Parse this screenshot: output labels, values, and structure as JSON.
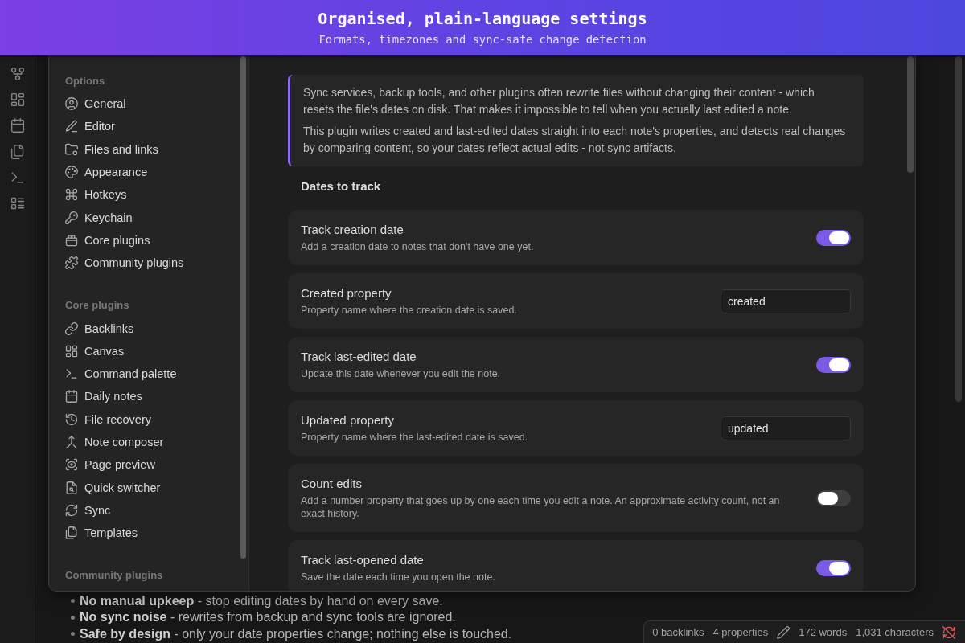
{
  "banner": {
    "title": "Organised, plain-language settings",
    "subtitle": "Formats, timezones and sync-safe change detection"
  },
  "settings_modal": {
    "sidebar": {
      "sections": [
        {
          "heading": "Options",
          "items": [
            {
              "label": "General",
              "selected": false
            },
            {
              "label": "Editor",
              "selected": false
            },
            {
              "label": "Files and links",
              "selected": false
            },
            {
              "label": "Appearance",
              "selected": false
            },
            {
              "label": "Hotkeys",
              "selected": false
            },
            {
              "label": "Keychain",
              "selected": false
            },
            {
              "label": "Core plugins",
              "selected": false
            },
            {
              "label": "Community plugins",
              "selected": false
            }
          ]
        },
        {
          "heading": "Core plugins",
          "items": [
            {
              "label": "Backlinks",
              "selected": false
            },
            {
              "label": "Canvas",
              "selected": false
            },
            {
              "label": "Command palette",
              "selected": false
            },
            {
              "label": "Daily notes",
              "selected": false
            },
            {
              "label": "File recovery",
              "selected": false
            },
            {
              "label": "Note composer",
              "selected": false
            },
            {
              "label": "Page preview",
              "selected": false
            },
            {
              "label": "Quick switcher",
              "selected": false
            },
            {
              "label": "Sync",
              "selected": false
            },
            {
              "label": "Templates",
              "selected": false
            }
          ]
        },
        {
          "heading": "Community plugins"
        }
      ]
    },
    "content": {
      "callout": {
        "paragraphs": [
          "Sync services, backup tools, and other plugins often rewrite files without changing their content - which resets the file's dates on disk. That makes it impossible to tell when you actually last edited a note.",
          "This plugin writes created and last-edited dates straight into each note's properties, and detects real changes by comparing content, so your dates reflect actual edits - not sync artifacts."
        ]
      },
      "section_heading": "Dates to track",
      "settings": [
        {
          "kind": "toggle",
          "name": "Track creation date",
          "description": "Add a creation date to notes that don't have one yet.",
          "on": true
        },
        {
          "kind": "text",
          "name": "Created property",
          "description": "Property name where the creation date is saved.",
          "value": "created"
        },
        {
          "kind": "toggle",
          "name": "Track last-edited date",
          "description": "Update this date whenever you edit the note.",
          "on": true
        },
        {
          "kind": "text",
          "name": "Updated property",
          "description": "Property name where the last-edited date is saved.",
          "value": "updated"
        },
        {
          "kind": "toggle",
          "name": "Count edits",
          "description": "Add a number property that goes up by one each time you edit a note. An approximate activity count, not an exact history.",
          "on": false
        },
        {
          "kind": "toggle",
          "name": "Track last-opened date",
          "description": "Save the date each time you open the note.",
          "on": true
        }
      ]
    }
  },
  "note": {
    "bullets": [
      "**No manual upkeep** - stop editing dates by hand on every save.",
      "**No sync noise** - rewrites from backup and sync tools are ignored.",
      "**Safe by design** - only your date properties change; nothing else is touched."
    ]
  },
  "status_bar": {
    "backlinks": "0 backlinks",
    "properties": "4 properties",
    "words": "172 words",
    "characters": "1,031 characters"
  }
}
